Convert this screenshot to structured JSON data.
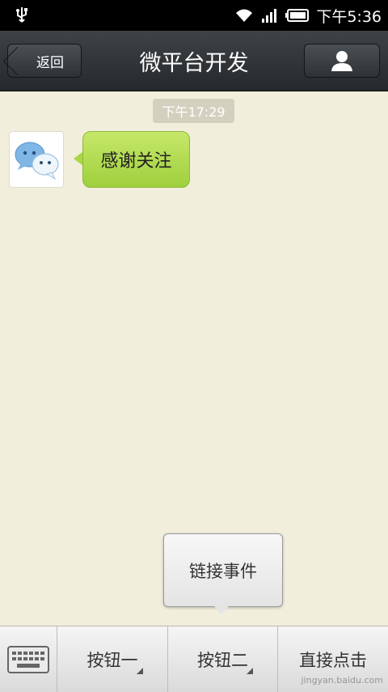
{
  "status_bar": {
    "time": "下午5:36",
    "icons": [
      "usb-icon",
      "wifi-icon",
      "signal-icon",
      "battery-icon"
    ]
  },
  "header": {
    "back_label": "返回",
    "title": "微平台开发",
    "profile_icon": "person-icon"
  },
  "chat": {
    "timestamp": "下午17:29",
    "messages": [
      {
        "sender_avatar": "wechat-chat-icon",
        "text": "感谢关注",
        "bubble_color": "#a8d645"
      }
    ]
  },
  "popup_menu": {
    "items": [
      "链接事件"
    ]
  },
  "bottom_menu": {
    "keyboard_icon": "keyboard-icon",
    "buttons": [
      {
        "label": "按钮一",
        "has_submenu": true
      },
      {
        "label": "按钮二",
        "has_submenu": true
      },
      {
        "label": "直接点击",
        "has_submenu": false
      }
    ]
  },
  "watermark": "jingyan.baidu.com",
  "colors": {
    "background": "#f1eedb",
    "titlebar": "#2f3438",
    "bubble_green": "#a8d645",
    "timestamp_bg": "#d4d0bf"
  }
}
